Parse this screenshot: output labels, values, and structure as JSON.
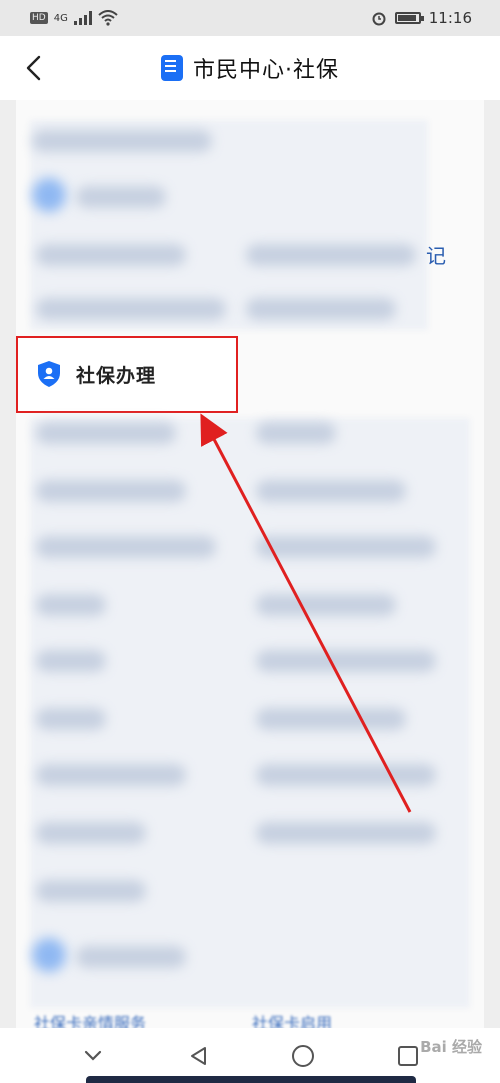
{
  "status_bar": {
    "network": "HD",
    "signal": "4G",
    "time": "11:16"
  },
  "header": {
    "title": "市民中心·社保",
    "back_icon": "chevron-left-icon",
    "title_icon": "document-icon"
  },
  "section": {
    "title": "社保办理",
    "icon": "shield-user-icon",
    "accent_color": "#1b6ff5",
    "highlight_color": "#e02020"
  },
  "partial_link_text": "记",
  "bottom_items": [
    {
      "label": "社保卡亲情服务"
    },
    {
      "label": "社保卡启用"
    }
  ],
  "nav": {
    "back_icon": "triangle-back-icon",
    "home_icon": "circle-home-icon",
    "recent_icon": "square-recent-icon",
    "collapse_icon": "chevron-down-icon"
  },
  "watermark": "Bai 经验"
}
